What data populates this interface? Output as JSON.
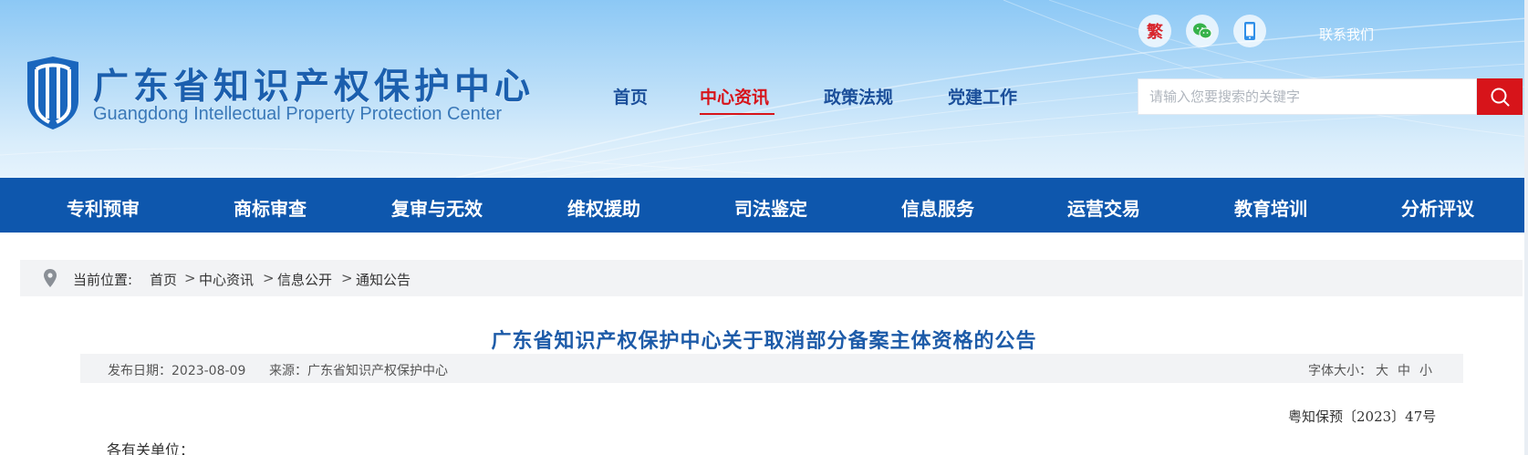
{
  "header": {
    "title_cn": "广东省知识产权保护中心",
    "title_en": "Guangdong Intellectual Property Protection Center",
    "icons": [
      {
        "name": "traditional-chinese-icon",
        "label": "繁"
      },
      {
        "name": "wechat-icon"
      },
      {
        "name": "mobile-icon"
      }
    ],
    "contact_label": "联系我们",
    "nav": [
      "首页",
      "中心资讯",
      "政策法规",
      "党建工作"
    ],
    "active_nav": "中心资讯",
    "search": {
      "placeholder": "请输入您要搜索的关键字"
    }
  },
  "sub_nav": [
    "专利预审",
    "商标审查",
    "复审与无效",
    "维权援助",
    "司法鉴定",
    "信息服务",
    "运营交易",
    "教育培训",
    "分析评议"
  ],
  "breadcrumb": {
    "prefix": "当前位置:",
    "items": [
      "首页",
      "中心资讯",
      "信息公开",
      "通知公告"
    ],
    "separator": ">"
  },
  "article": {
    "title": "广东省知识产权保护中心关于取消部分备案主体资格的公告",
    "date": "发布日期：2023-08-09",
    "source": "来源：广东省知识产权保护中心",
    "font_size_label": "字体大小：",
    "font_sizes": [
      "大",
      "中",
      "小"
    ],
    "doc_number": "粤知保预〔2023〕47号",
    "salutation": "各有关单位："
  },
  "colors": {
    "brand_blue": "#0e57ad",
    "title_blue": "#1d5ba8",
    "accent_red": "#d7141a"
  }
}
